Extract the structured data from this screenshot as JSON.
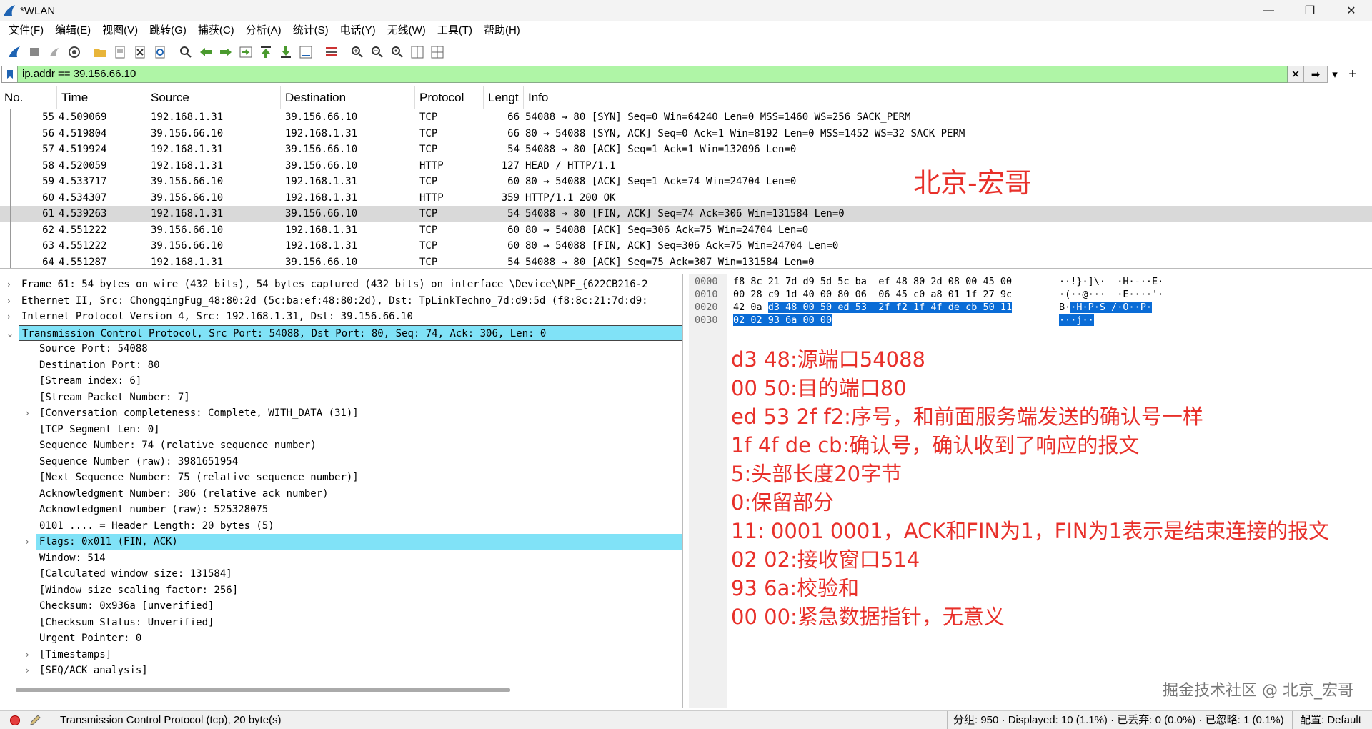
{
  "window": {
    "title": "*WLAN",
    "minimize": "—",
    "restore": "❐",
    "close": "✕"
  },
  "menu": [
    "文件(F)",
    "编辑(E)",
    "视图(V)",
    "跳转(G)",
    "捕获(C)",
    "分析(A)",
    "统计(S)",
    "电话(Y)",
    "无线(W)",
    "工具(T)",
    "帮助(H)"
  ],
  "filter": {
    "value": "ip.addr == 39.156.66.10",
    "clear_glyph": "✕",
    "apply_glyph": "➡",
    "dropdown_glyph": "▾",
    "add_glyph": "+"
  },
  "packet_list": {
    "columns": [
      "No.",
      "Time",
      "Source",
      "Destination",
      "Protocol",
      "Lengt",
      "Info"
    ],
    "rows": [
      {
        "no": "55",
        "time": "4.509069",
        "src": "192.168.1.31",
        "dst": "39.156.66.10",
        "proto": "TCP",
        "len": "66",
        "info": "54088 → 80 [SYN] Seq=0 Win=64240 Len=0 MSS=1460 WS=256 SACK_PERM"
      },
      {
        "no": "56",
        "time": "4.519804",
        "src": "39.156.66.10",
        "dst": "192.168.1.31",
        "proto": "TCP",
        "len": "66",
        "info": "80 → 54088 [SYN, ACK] Seq=0 Ack=1 Win=8192 Len=0 MSS=1452 WS=32 SACK_PERM"
      },
      {
        "no": "57",
        "time": "4.519924",
        "src": "192.168.1.31",
        "dst": "39.156.66.10",
        "proto": "TCP",
        "len": "54",
        "info": "54088 → 80 [ACK] Seq=1 Ack=1 Win=132096 Len=0"
      },
      {
        "no": "58",
        "time": "4.520059",
        "src": "192.168.1.31",
        "dst": "39.156.66.10",
        "proto": "HTTP",
        "len": "127",
        "info": "HEAD / HTTP/1.1"
      },
      {
        "no": "59",
        "time": "4.533717",
        "src": "39.156.66.10",
        "dst": "192.168.1.31",
        "proto": "TCP",
        "len": "60",
        "info": "80 → 54088 [ACK] Seq=1 Ack=74 Win=24704 Len=0"
      },
      {
        "no": "60",
        "time": "4.534307",
        "src": "39.156.66.10",
        "dst": "192.168.1.31",
        "proto": "HTTP",
        "len": "359",
        "info": "HTTP/1.1 200 OK"
      },
      {
        "no": "61",
        "time": "4.539263",
        "src": "192.168.1.31",
        "dst": "39.156.66.10",
        "proto": "TCP",
        "len": "54",
        "info": "54088 → 80 [FIN, ACK] Seq=74 Ack=306 Win=131584 Len=0"
      },
      {
        "no": "62",
        "time": "4.551222",
        "src": "39.156.66.10",
        "dst": "192.168.1.31",
        "proto": "TCP",
        "len": "60",
        "info": "80 → 54088 [ACK] Seq=306 Ack=75 Win=24704 Len=0"
      },
      {
        "no": "63",
        "time": "4.551222",
        "src": "39.156.66.10",
        "dst": "192.168.1.31",
        "proto": "TCP",
        "len": "60",
        "info": "80 → 54088 [FIN, ACK] Seq=306 Ack=75 Win=24704 Len=0"
      },
      {
        "no": "64",
        "time": "4.551287",
        "src": "192.168.1.31",
        "dst": "39.156.66.10",
        "proto": "TCP",
        "len": "54",
        "info": "54088 → 80 [ACK] Seq=75 Ack=307 Win=131584 Len=0"
      }
    ],
    "overlay_text": "北京-宏哥"
  },
  "details": {
    "top": [
      "Frame 61: 54 bytes on wire (432 bits), 54 bytes captured (432 bits) on interface \\Device\\NPF_{622CB216-2",
      "Ethernet II, Src: ChongqingFug_48:80:2d (5c:ba:ef:48:80:2d), Dst: TpLinkTechno_7d:d9:5d (f8:8c:21:7d:d9:",
      "Internet Protocol Version 4, Src: 192.168.1.31, Dst: 39.156.66.10",
      "Transmission Control Protocol, Src Port: 54088, Dst Port: 80, Seq: 74, Ack: 306, Len: 0"
    ],
    "tcp": [
      "Source Port: 54088",
      "Destination Port: 80",
      "[Stream index: 6]",
      "[Stream Packet Number: 7]",
      "[Conversation completeness: Complete, WITH_DATA (31)]",
      "[TCP Segment Len: 0]",
      "Sequence Number: 74    (relative sequence number)",
      "Sequence Number (raw): 3981651954",
      "[Next Sequence Number: 75    (relative sequence number)]",
      "Acknowledgment Number: 306    (relative ack number)",
      "Acknowledgment number (raw): 525328075",
      "0101 .... = Header Length: 20 bytes (5)",
      "Flags: 0x011 (FIN, ACK)",
      "Window: 514",
      "[Calculated window size: 131584]",
      "[Window size scaling factor: 256]",
      "Checksum: 0x936a [unverified]",
      "[Checksum Status: Unverified]",
      "Urgent Pointer: 0",
      "[Timestamps]",
      "[SEQ/ACK analysis]"
    ]
  },
  "bytes": {
    "offsets": [
      "0000",
      "0010",
      "0020",
      "0030"
    ],
    "hex_plain": [
      "f8 8c 21 7d d9 5d 5c ba  ef 48 80 2d 08 00 45 00",
      "00 28 c9 1d 40 00 80 06  06 45 c0 a8 01 1f 27 9c",
      "42 0a "
    ],
    "hex_sel_2": "d3 48 00 50 ed 53  2f f2 1f 4f de cb 50 11",
    "hex_sel_3": "02 02 93 6a 00 00",
    "ascii_plain": [
      "··!}·]\\·  ·H·-··E·",
      "·(··@···  ·E····'·",
      "B·"
    ],
    "ascii_sel_2": "·H·P·S /·O··P·",
    "ascii_sel_3": "···j··",
    "annotations": [
      "d3 48:源端口54088",
      "00 50:目的端口80",
      "ed 53 2f f2:序号，和前面服务端发送的确认号一样",
      "1f 4f de cb:确认号，确认收到了响应的报文",
      "5:头部长度20字节",
      "0:保留部分",
      "11: 0001 0001，ACK和FIN为1，FIN为1表示是结束连接的报文",
      "02 02:接收窗口514",
      "93 6a:校验和",
      "00 00:紧急数据指针，无意义"
    ],
    "watermark": "掘金技术社区 @ 北京_宏哥"
  },
  "status": {
    "left": "Transmission Control Protocol (tcp), 20 byte(s)",
    "right": "分组: 950 · Displayed: 10 (1.1%) · 已丢弃: 0 (0.0%) · 已忽略: 1 (0.1%)",
    "profile": "配置: Default"
  },
  "colors": {
    "filter_valid": "#aff5a6",
    "selection": "#80e2f7",
    "annotation": "#e8302a",
    "hex_selected": "#0a6cd6"
  }
}
